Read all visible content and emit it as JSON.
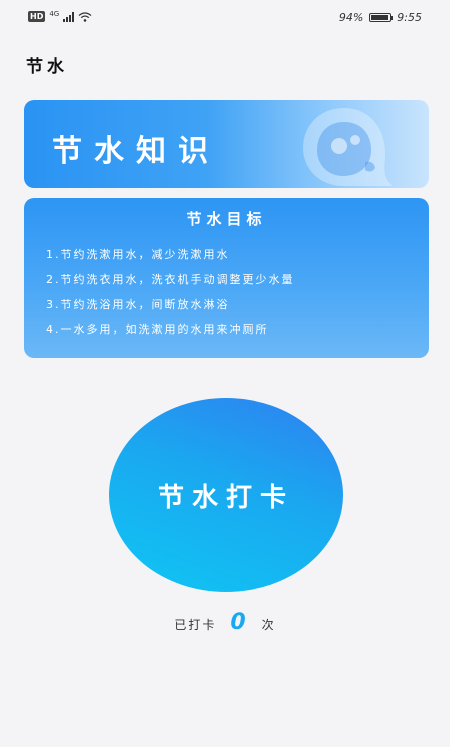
{
  "status_bar": {
    "hd_label": "HD",
    "network_label": "4G",
    "battery_text": "94%",
    "battery_level": 0.94,
    "time": "9:55"
  },
  "header": {
    "title": "节水"
  },
  "banner": {
    "title": "节水知识"
  },
  "goals": {
    "title": "节水目标",
    "items": [
      "1.节约洗漱用水，减少洗漱用水",
      "2.节约洗衣用水，洗衣机手动调整更少水量",
      "3.节约洗浴用水，间断放水淋浴",
      "4.一水多用，如洗漱用的水用来冲厕所"
    ]
  },
  "checkin": {
    "button_label": "节水打卡",
    "count_prefix": "已打卡",
    "count_value": "0",
    "count_suffix": "次"
  },
  "colors": {
    "accent": "#2a93f3",
    "circle_start": "#2f80f0",
    "circle_end": "#0fc6f3",
    "count": "#1aa8f0"
  }
}
